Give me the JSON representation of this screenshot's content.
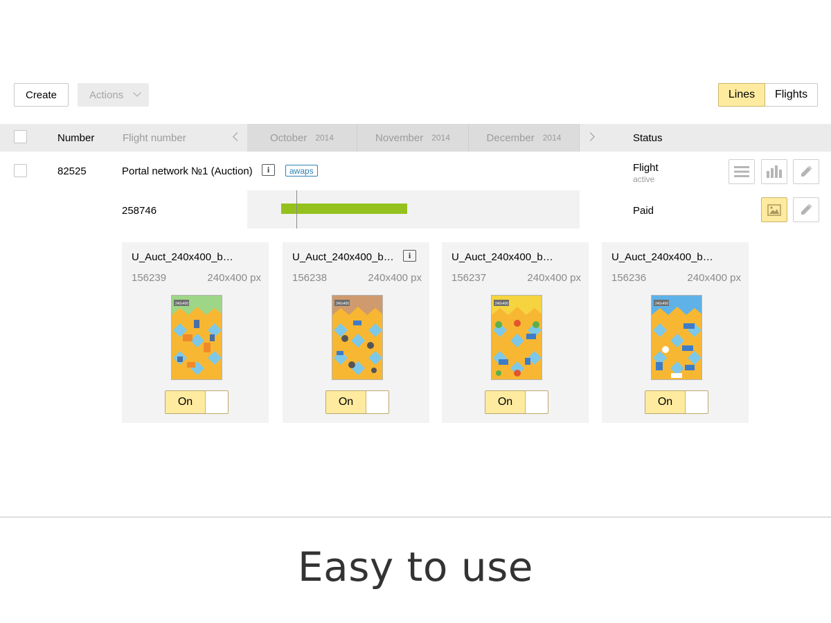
{
  "toolbar": {
    "create_label": "Create",
    "actions_label": "Actions",
    "view_options": [
      {
        "label": "Lines",
        "selected": true
      },
      {
        "label": "Flights",
        "selected": false
      }
    ]
  },
  "table_header": {
    "number": "Number",
    "flight_number": "Flight number",
    "months": [
      {
        "name": "October",
        "year": "2014"
      },
      {
        "name": "November",
        "year": "2014"
      },
      {
        "name": "December",
        "year": "2014"
      }
    ],
    "status": "Status"
  },
  "campaign": {
    "number": "82525",
    "name": "Portal network №1 (Auction)",
    "info_glyph": "i",
    "tag": "awaps",
    "status": "Flight",
    "status_sub": "active"
  },
  "flight": {
    "number": "258746",
    "status": "Paid",
    "timeline_progress_fraction": 0.38
  },
  "creatives": [
    {
      "title": "U_Auct_240x400_b…",
      "id": "156239",
      "size": "240x400 px",
      "badge": "240x400",
      "theme": "buildings",
      "has_info": false,
      "toggle": "On"
    },
    {
      "title": "U_Auct_240x400_b…",
      "id": "156238",
      "size": "240x400 px",
      "badge": "240x400",
      "theme": "cars",
      "has_info": true,
      "toggle": "On"
    },
    {
      "title": "U_Auct_240x400_b…",
      "id": "156237",
      "size": "240x400 px",
      "badge": "240x400",
      "theme": "traffic",
      "has_info": false,
      "toggle": "On"
    },
    {
      "title": "U_Auct_240x400_b…",
      "id": "156236",
      "size": "240x400 px",
      "badge": "240x400",
      "theme": "travel",
      "has_info": false,
      "toggle": "On"
    }
  ],
  "footer": {
    "tagline": "Easy to use"
  },
  "colors": {
    "accent_yellow": "#ffeba0",
    "bar_green": "#95c11f",
    "tag_blue": "#2f7fb5"
  }
}
